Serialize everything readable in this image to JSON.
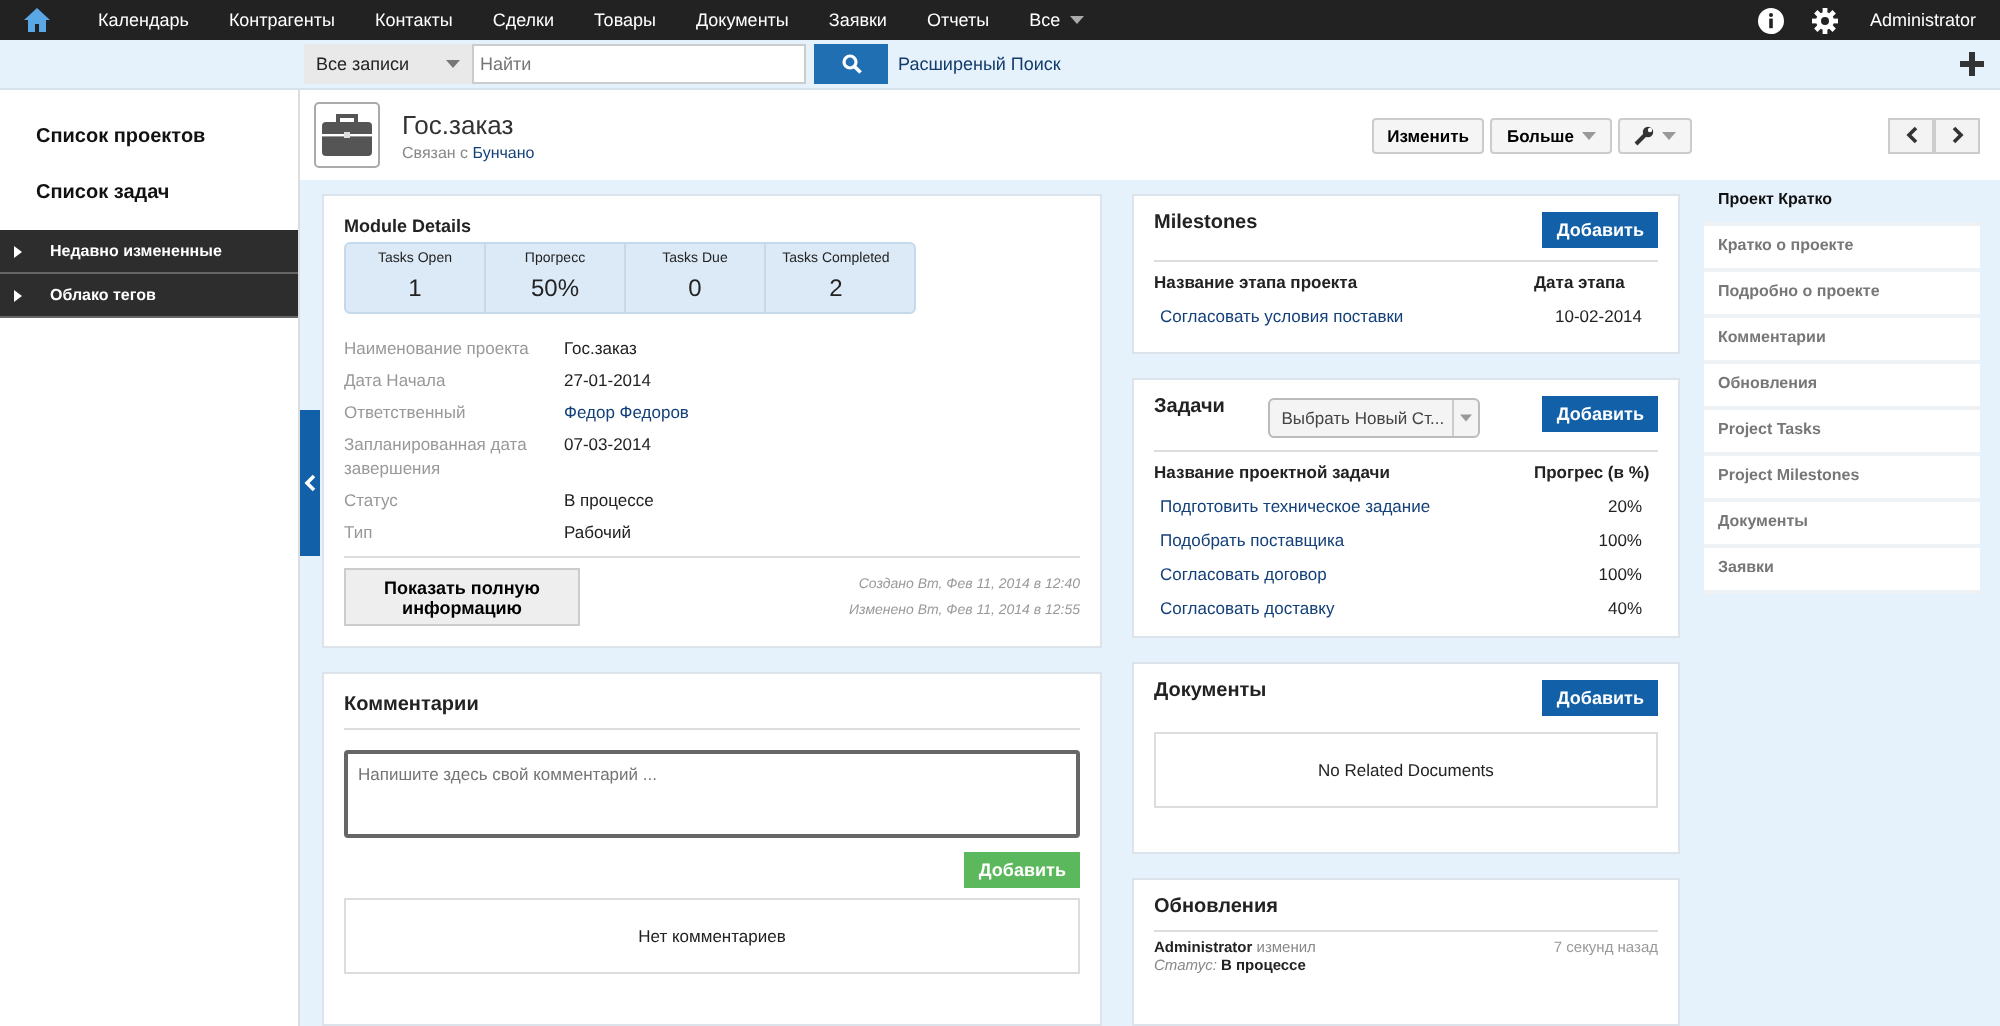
{
  "nav": {
    "items": [
      "Календарь",
      "Контрагенты",
      "Контакты",
      "Сделки",
      "Товары",
      "Документы",
      "Заявки",
      "Отчеты",
      "Все"
    ],
    "user": "Administrator"
  },
  "search": {
    "scope": "Все записи",
    "placeholder": "Найти",
    "advanced": "Расширеный Поиск"
  },
  "sidebar": {
    "links": [
      "Список проектов",
      "Список задач"
    ],
    "sections": [
      "Недавно измененные",
      "Облако тегов"
    ]
  },
  "record": {
    "title": "Гос.заказ",
    "related_prefix": "Связан с",
    "related": "Бунчано",
    "buttons": [
      "Изменить",
      "Больше"
    ]
  },
  "details": {
    "title": "Module Details",
    "stats": [
      {
        "label": "Tasks Open",
        "value": "1"
      },
      {
        "label": "Прогресс",
        "value": "50%"
      },
      {
        "label": "Tasks Due",
        "value": "0"
      },
      {
        "label": "Tasks Completed",
        "value": "2"
      }
    ],
    "fields": [
      {
        "label": "Наименование проекта",
        "value": "Гос.заказ",
        "kind": "text"
      },
      {
        "label": "Дата Начала",
        "value": "27-01-2014",
        "kind": "text"
      },
      {
        "label": "Ответственный",
        "value": "Федор Федоров",
        "kind": "link"
      },
      {
        "label": "Запланированная дата завершения",
        "value": "07-03-2014",
        "kind": "text"
      },
      {
        "label": "Статус",
        "value": "В процессе",
        "kind": "text"
      },
      {
        "label": "Тип",
        "value": "Рабочий",
        "kind": "text"
      }
    ],
    "show_full": "Показать полную информацию",
    "created": "Создано Вт, Фев 11, 2014 в 12:40",
    "modified": "Изменено Вт, Фев 11, 2014 в 12:55"
  },
  "comments": {
    "title": "Комментарии",
    "placeholder": "Напишите здесь свой комментарий ...",
    "add": "Добавить",
    "empty": "Нет комментариев"
  },
  "milestones": {
    "title": "Milestones",
    "add": "Добавить",
    "columns": [
      "Название этапа проекта",
      "Дата этапа"
    ],
    "rows": [
      [
        "Согласовать условия поставки",
        "10-02-2014"
      ]
    ]
  },
  "tasks": {
    "title": "Задачи",
    "select": "Выбрать Новый Ст...",
    "add": "Добавить",
    "columns": [
      "Название проектной задачи",
      "Прогрес (в %)"
    ],
    "rows": [
      [
        "Подготовить техническое задание",
        "20%"
      ],
      [
        "Подобрать поставщика",
        "100%"
      ],
      [
        "Согласовать договор",
        "100%"
      ],
      [
        "Согласовать доставку",
        "40%"
      ]
    ]
  },
  "documents": {
    "title": "Документы",
    "add": "Добавить",
    "empty": "No Related Documents"
  },
  "updates": {
    "title": "Обновления",
    "entries": [
      {
        "user": "Administrator",
        "action": "изменил",
        "time": "7 секунд назад",
        "field": "Статус:",
        "value": "В процессе"
      }
    ]
  },
  "summary_nav": [
    {
      "label": "Проект Кратко",
      "selected": true
    },
    {
      "label": "Кратко о проекте",
      "selected": false
    },
    {
      "label": "Подробно о проекте",
      "selected": false
    },
    {
      "label": "Комментарии",
      "selected": false
    },
    {
      "label": "Обновления",
      "selected": false
    },
    {
      "label": "Project Tasks",
      "selected": false
    },
    {
      "label": "Project Milestones",
      "selected": false
    },
    {
      "label": "Документы",
      "selected": false
    },
    {
      "label": "Заявки",
      "selected": false
    }
  ]
}
